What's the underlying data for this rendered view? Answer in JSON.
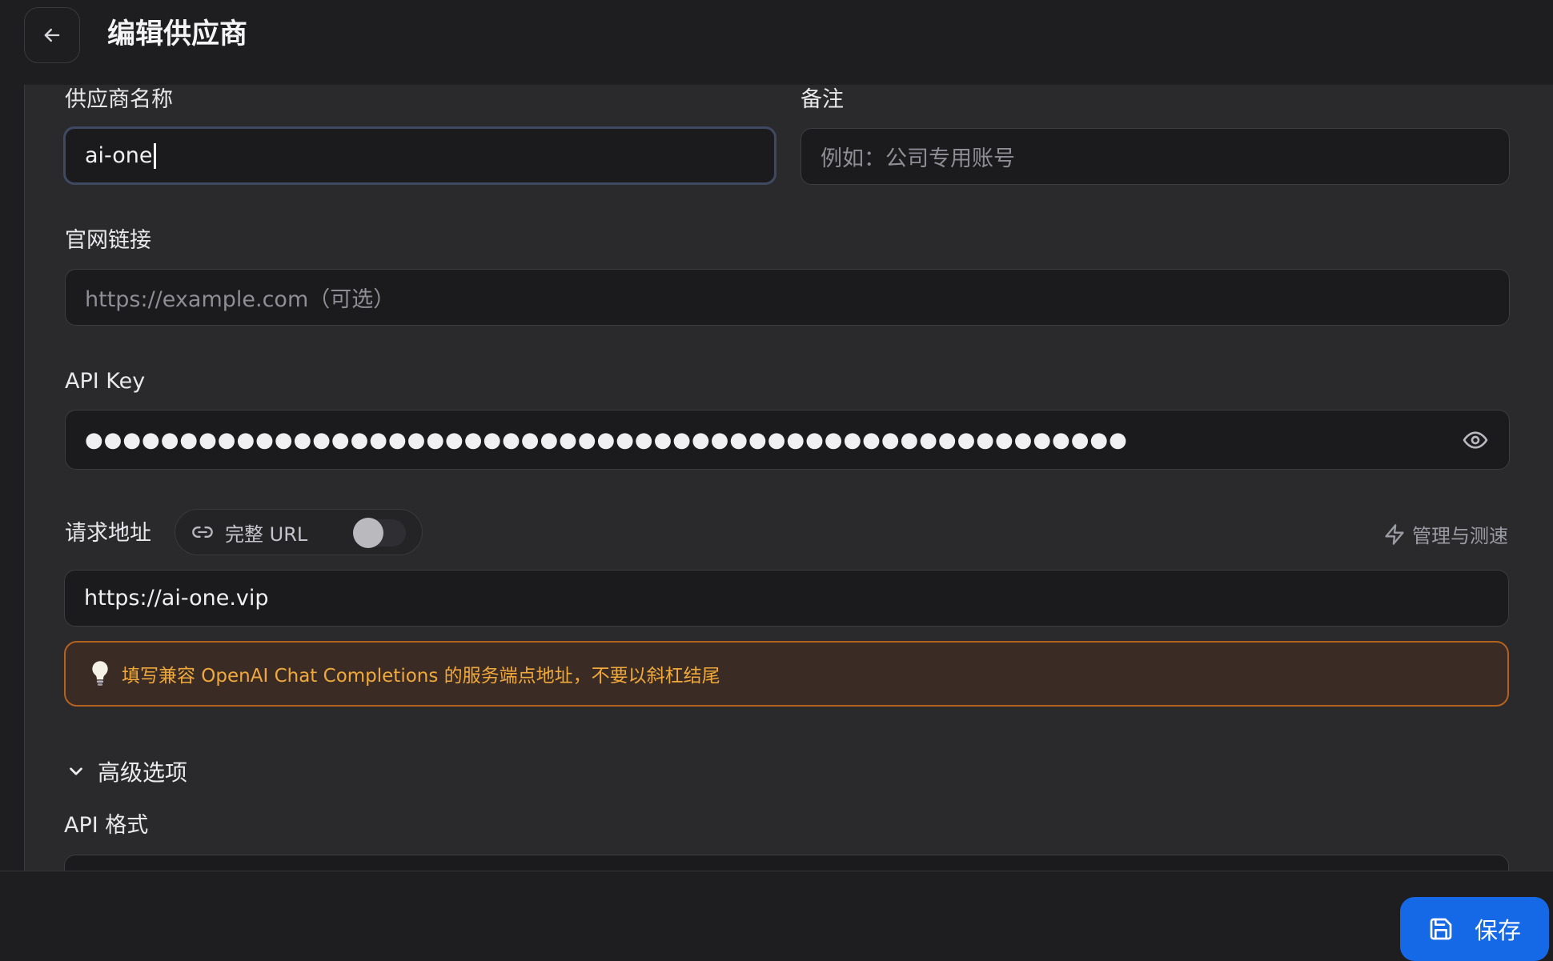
{
  "header": {
    "title": "编辑供应商"
  },
  "form": {
    "name": {
      "label": "供应商名称",
      "value": "ai-one"
    },
    "note": {
      "label": "备注",
      "placeholder": "例如：公司专用账号"
    },
    "website": {
      "label": "官网链接",
      "placeholder": "https://example.com（可选）"
    },
    "api_key": {
      "label": "API Key",
      "masked_value": "●●●●●●●●●●●●●●●●●●●●●●●●●●●●●●●●●●●●●●●●●●●●●●●●●●●●●●●"
    },
    "endpoint": {
      "label": "请求地址",
      "full_url_label": "完整 URL",
      "full_url_enabled": false,
      "manage_label": "管理与测速",
      "value": "https://ai-one.vip",
      "hint": "填写兼容 OpenAI Chat Completions 的服务端点地址，不要以斜杠结尾"
    },
    "advanced": {
      "label": "高级选项",
      "api_format_label": "API 格式"
    }
  },
  "footer": {
    "save_label": "保存"
  },
  "colors": {
    "accent": "#1669e6",
    "hint_border": "#b5621f",
    "hint_text": "#f0a93a"
  }
}
